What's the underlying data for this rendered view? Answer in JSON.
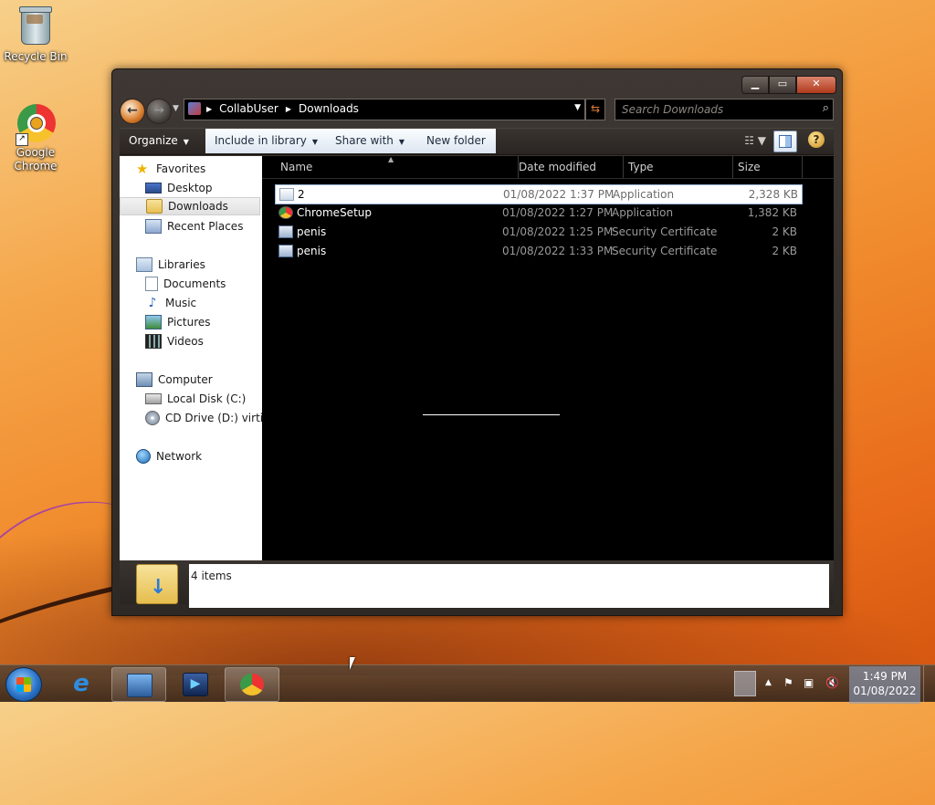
{
  "desktop": {
    "icons": [
      {
        "label": "Recycle Bin"
      },
      {
        "label": "Google Chrome"
      }
    ]
  },
  "window": {
    "breadcrumb": [
      "CollabUser",
      "Downloads"
    ],
    "search_placeholder": "Search Downloads",
    "toolbar": {
      "organize": "Organize",
      "include_in_library": "Include in library",
      "share_with": "Share with",
      "new_folder": "New folder"
    },
    "nav": {
      "favorites": "Favorites",
      "desktop": "Desktop",
      "downloads": "Downloads",
      "recent_places": "Recent Places",
      "libraries": "Libraries",
      "documents": "Documents",
      "music": "Music",
      "pictures": "Pictures",
      "videos": "Videos",
      "computer": "Computer",
      "local_disk": "Local Disk (C:)",
      "cd_drive": "CD Drive (D:) virtio-w",
      "network": "Network"
    },
    "columns": {
      "name": "Name",
      "date_modified": "Date modified",
      "type": "Type",
      "size": "Size"
    },
    "files": [
      {
        "name": "2",
        "date": "01/08/2022 1:37 PM",
        "type": "Application",
        "size": "2,328 KB",
        "icon": "application-icon"
      },
      {
        "name": "ChromeSetup",
        "date": "01/08/2022 1:27 PM",
        "type": "Application",
        "size": "1,382 KB",
        "icon": "chrome-setup-icon"
      },
      {
        "name": "penis",
        "date": "01/08/2022 1:25 PM",
        "type": "Security Certificate",
        "size": "2 KB",
        "icon": "certificate-icon"
      },
      {
        "name": "penis",
        "date": "01/08/2022 1:33 PM",
        "type": "Security Certificate",
        "size": "2 KB",
        "icon": "certificate-icon"
      }
    ],
    "selected_file_index": 0,
    "status": "4 items"
  },
  "taskbar": {
    "clock_time": "1:49 PM",
    "clock_date": "01/08/2022"
  }
}
